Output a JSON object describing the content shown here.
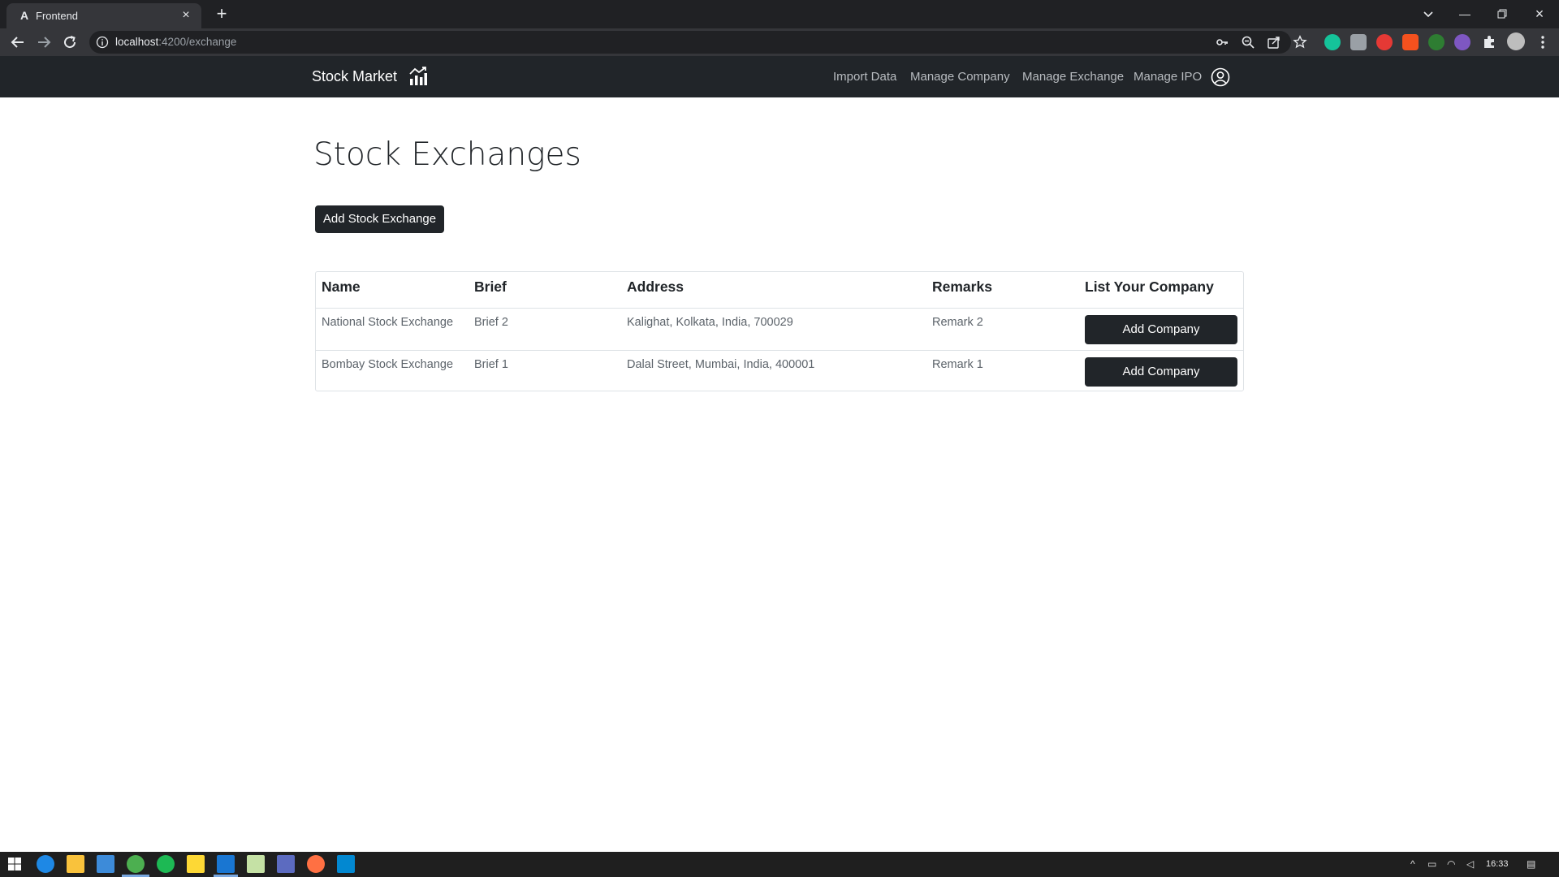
{
  "browser": {
    "tab_title": "Frontend",
    "tab_favicon": "A",
    "new_tab_label": "+",
    "url_host": "localhost",
    "url_rest": ":4200/exchange"
  },
  "navbar": {
    "brand": "Stock Market",
    "links": [
      "Import Data",
      "Manage Company",
      "Manage Exchange",
      "Manage IPO"
    ]
  },
  "main": {
    "title": "Stock Exchanges",
    "add_button": "Add Stock Exchange",
    "table": {
      "headers": [
        "Name",
        "Brief",
        "Address",
        "Remarks",
        "List Your Company"
      ],
      "rows": [
        {
          "name": "National Stock Exchange",
          "brief": "Brief 2",
          "address": "Kalighat, Kolkata, India, 700029",
          "remarks": "Remark 2",
          "action": "Add Company"
        },
        {
          "name": "Bombay Stock Exchange",
          "brief": "Brief 1",
          "address": "Dalal Street, Mumbai, India, 400001",
          "remarks": "Remark 1",
          "action": "Add Company"
        }
      ]
    }
  },
  "taskbar": {
    "clock": "16:33"
  },
  "colors": {
    "navbar_bg": "#212529",
    "button_bg": "#212529",
    "browser_frame": "#202124",
    "browser_toolbar": "#35363a"
  }
}
